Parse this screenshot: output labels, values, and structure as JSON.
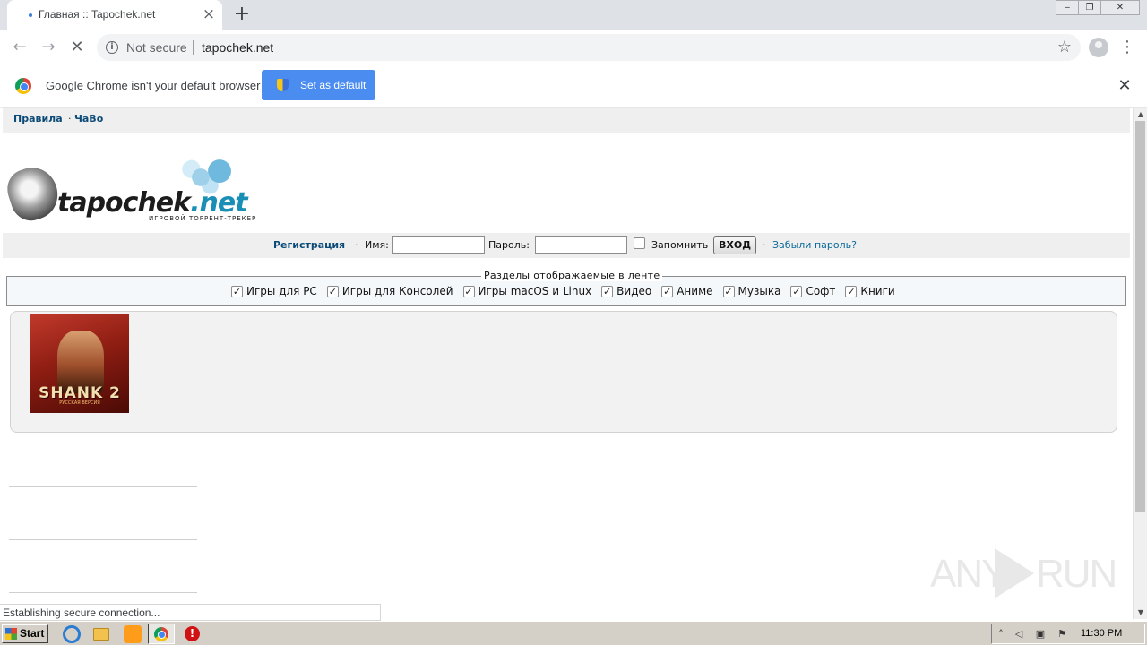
{
  "browser": {
    "tab_title": "Главная :: Tapochek.net",
    "new_tab": "+",
    "tab_close": "×",
    "security_label": "Not secure",
    "url": "tapochek.net",
    "infobar_text": "Google Chrome isn't your default browser",
    "set_default_label": "Set as default",
    "status_text": "Establishing secure connection..."
  },
  "site": {
    "topnav": [
      {
        "label": "Правила"
      },
      {
        "label": "ЧаВо"
      }
    ],
    "logo": {
      "name_main": "tapochek",
      "name_tld": ".net",
      "tagline": "ИГРОВОЙ ТОРРЕНТ-ТРЕКЕР"
    },
    "login": {
      "register": "Регистрация",
      "name_label": "Имя:",
      "name_value": "",
      "password_label": "Пароль:",
      "password_value": "",
      "remember_label": "Запомнить",
      "remember_checked": false,
      "enter_button": "ВХОД",
      "forgot": "Забыли пароль?"
    },
    "feed": {
      "legend": "Разделы отображаемые в ленте",
      "items": [
        {
          "label": "Игры для PC",
          "checked": true
        },
        {
          "label": "Игры для Консолей",
          "checked": true
        },
        {
          "label": "Игры macOS и Linux",
          "checked": true
        },
        {
          "label": "Видео",
          "checked": true
        },
        {
          "label": "Аниме",
          "checked": true
        },
        {
          "label": "Музыка",
          "checked": true
        },
        {
          "label": "Софт",
          "checked": true
        },
        {
          "label": "Книги",
          "checked": true
        }
      ]
    },
    "release_cover": {
      "title": "SHANK 2",
      "subtitle": "РУССКАЯ ВЕРСИЯ"
    }
  },
  "watermark": {
    "left": "ANY",
    "right": "RUN"
  },
  "taskbar": {
    "start_label": "Start",
    "clock": "11:30 PM"
  }
}
